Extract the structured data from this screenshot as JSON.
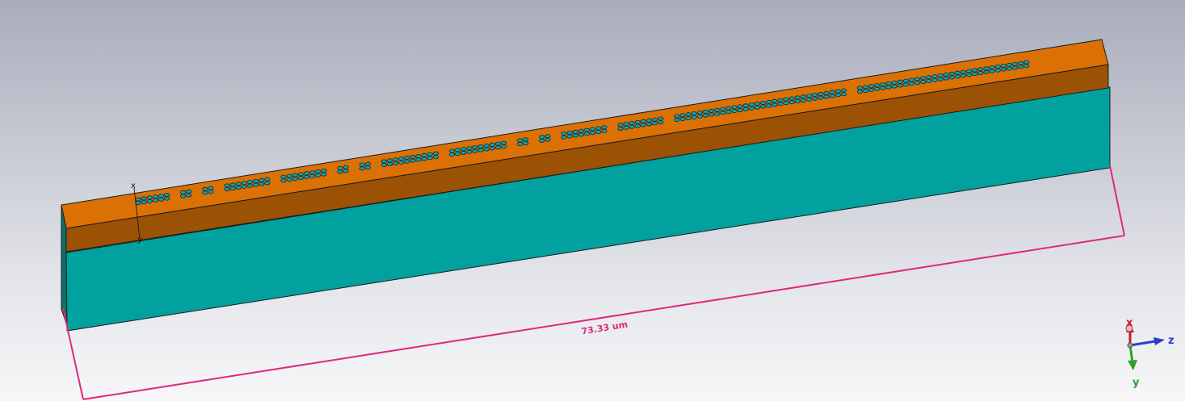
{
  "colors": {
    "background_top": "#a9adbb",
    "background_bottom": "#f7f7f8",
    "top_face": "#db7105",
    "mid_band": "#9c5204",
    "substrate": "#00a19f",
    "substrate_dark": "#0e6e6a",
    "dimension_line": "#e0287e",
    "edge": "#1b1b1b",
    "axis_x": "#c8172b",
    "axis_y": "#2fa12f",
    "axis_z": "#2d3fcf"
  },
  "dimension": {
    "label": "73.33 um"
  },
  "local_axes": {
    "x_label": "x",
    "y_label": "y"
  },
  "orientation_triad": {
    "x_label": "x",
    "y_label": "y",
    "z_label": "z"
  },
  "hole_array": {
    "rows": 2,
    "groups": [
      6,
      2,
      2,
      8,
      8,
      2,
      2,
      10,
      10,
      2,
      2,
      8,
      8,
      30,
      30
    ]
  }
}
